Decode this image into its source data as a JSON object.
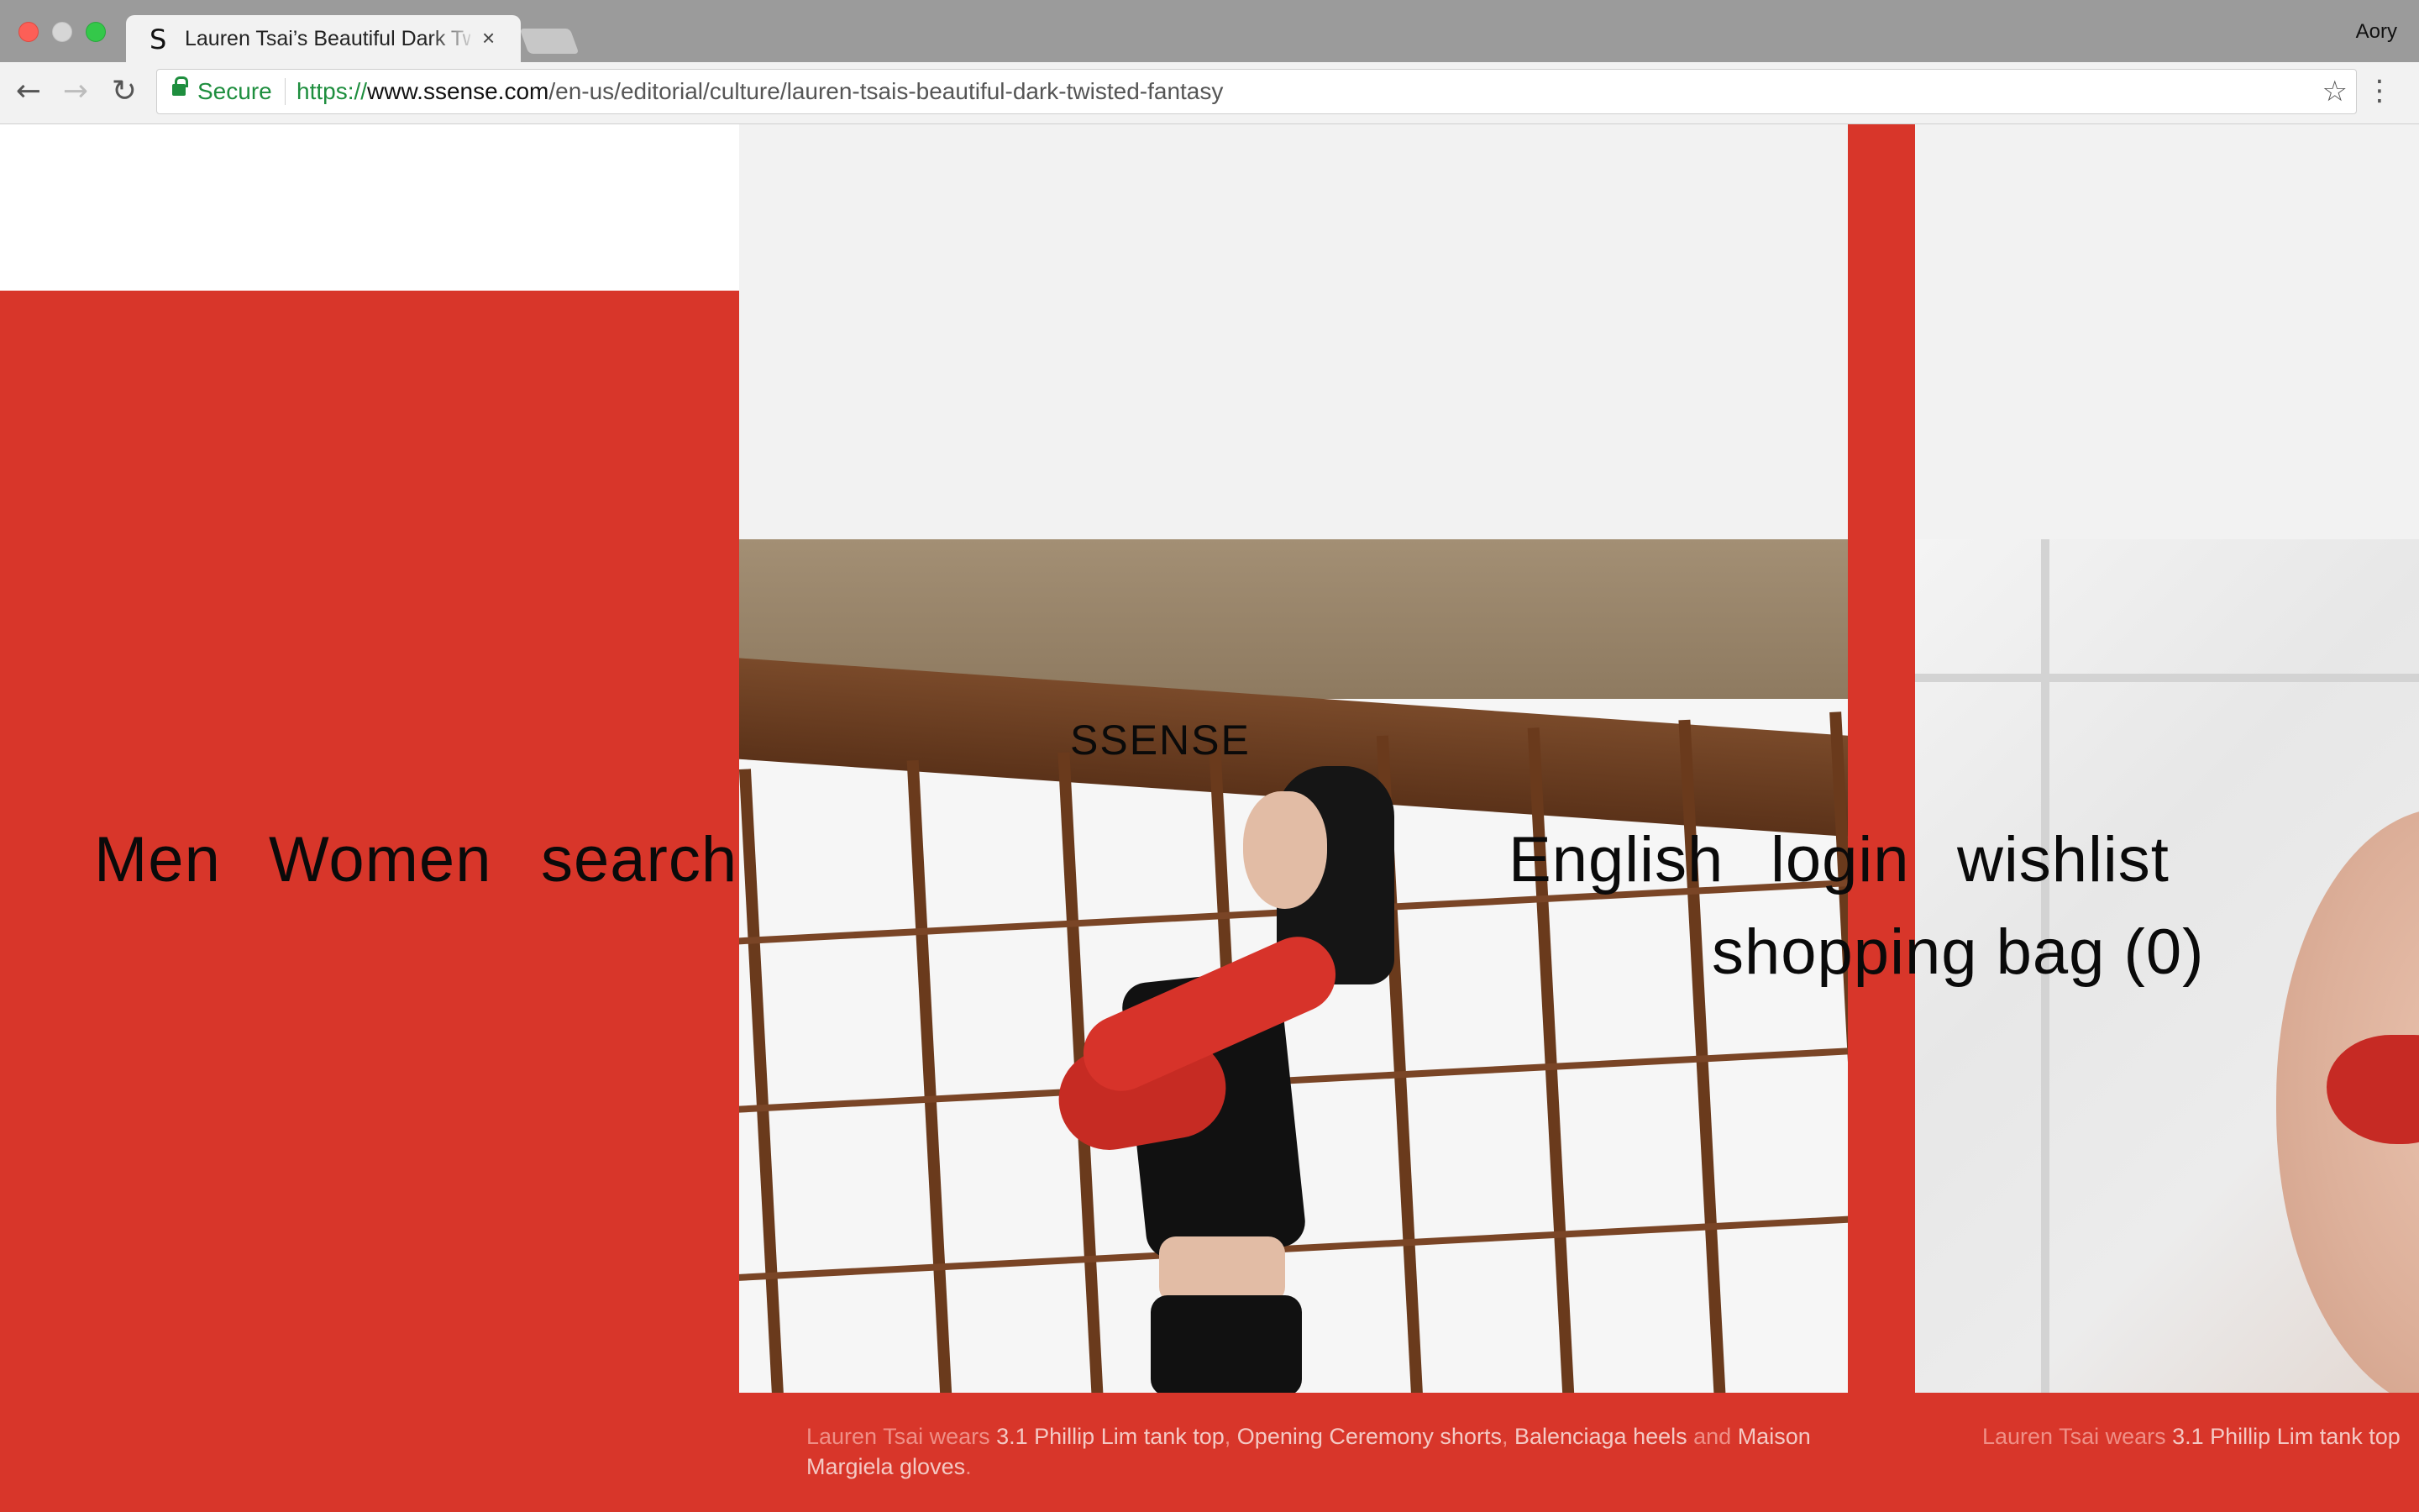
{
  "browser": {
    "tab_title": "Lauren Tsai’s Beautiful Dark Twisted Fantasy",
    "tab_favicon": "S",
    "tab_close": "×",
    "profile_name": "Aory",
    "secure_label": "Secure",
    "url_scheme": "https://",
    "url_host": "www.ssense.com",
    "url_path": "/en-us/editorial/culture/lauren-tsais-beautiful-dark-twisted-fantasy",
    "icons": {
      "back": "←",
      "forward": "→",
      "reload": "↻",
      "star": "☆",
      "menu": "⋮"
    }
  },
  "header": {
    "nav_left": [
      "Men",
      "Women",
      "search"
    ],
    "logo": "SSENSE",
    "nav_right": [
      "English",
      "login",
      "wishlist"
    ],
    "shopping_bag": "shopping bag (0)"
  },
  "captions": {
    "main": {
      "prefix": "Lauren Tsai wears ",
      "item1": "3.1 Phillip Lim tank top",
      "sep1": ", ",
      "item2": "Opening Ceremony shorts",
      "sep2": ", ",
      "item3": "Balenciaga heels",
      "and": " and ",
      "item4": "Maison Margiela gloves",
      "end": "."
    },
    "right": {
      "prefix": "Lauren Tsai wears ",
      "item1": "3.1 Phillip Lim tank top"
    }
  },
  "colors": {
    "brand_red": "#d8362a",
    "light_grey": "#f2f2f2",
    "secure_green": "#1e8e3e"
  }
}
